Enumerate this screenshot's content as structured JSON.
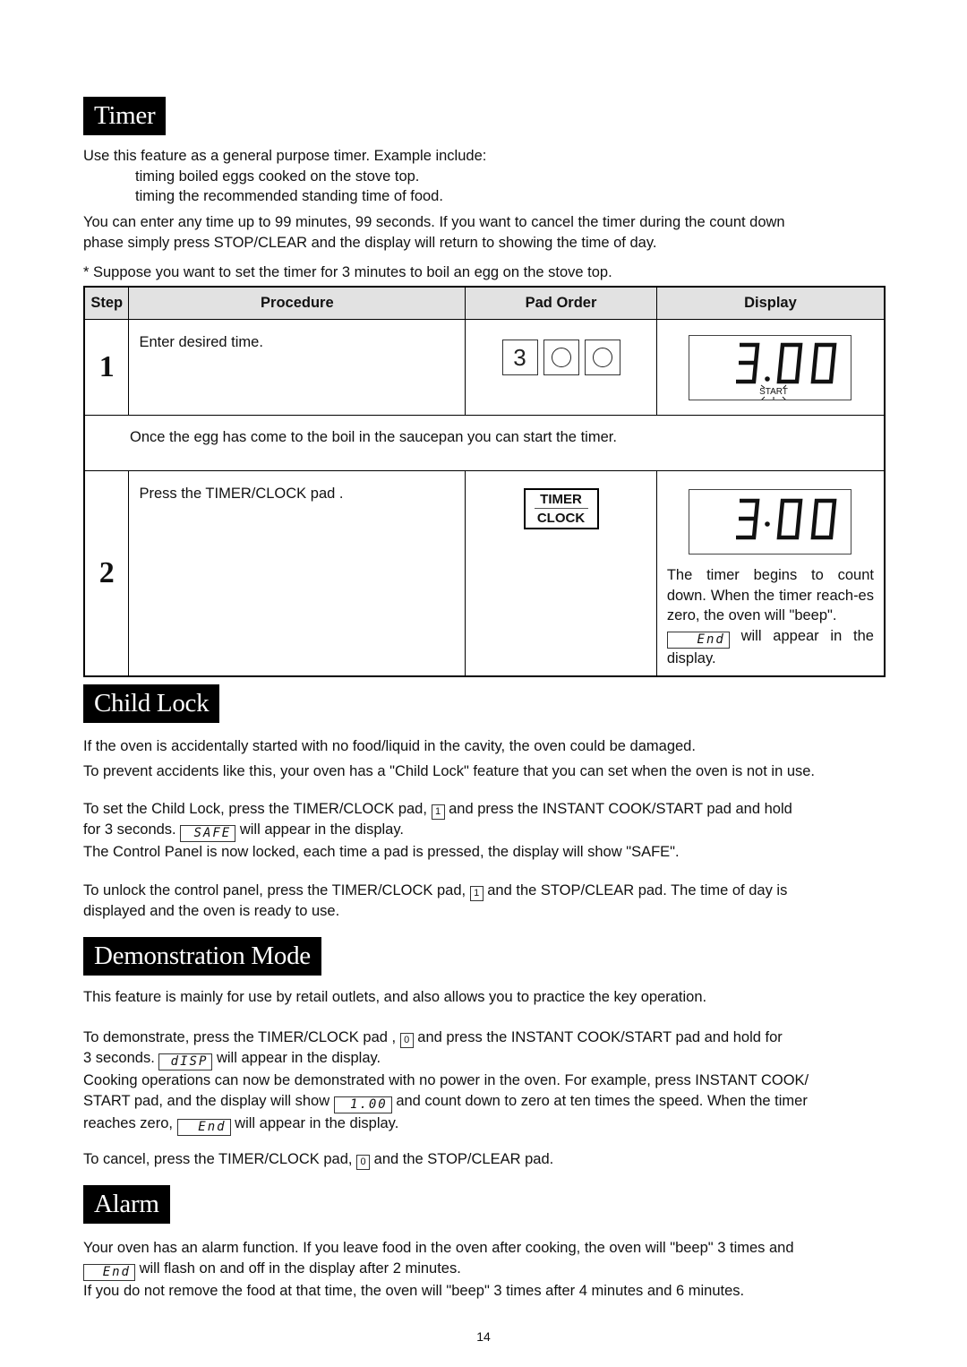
{
  "page_number": "14",
  "timer": {
    "heading": "Timer",
    "intro": "Use this feature as a general purpose timer. Example include:",
    "examples": [
      "timing boiled eggs cooked on the stove top.",
      "timing the recommended standing time of food."
    ],
    "para1_line1": "You can enter any time up to 99 minutes, 99 seconds. If you want to cancel the timer during the count down",
    "para1_line2": "phase simply press STOP/CLEAR and the display will return to showing the time of day.",
    "suppose": "* Suppose you want to set the timer for 3 minutes to boil an egg on the stove top.",
    "table": {
      "headers": [
        "Step",
        "Procedure",
        "Pad Order",
        "Display"
      ],
      "step1": {
        "number": "1",
        "procedure": "Enter desired time.",
        "pads": [
          "3",
          "0",
          "0"
        ],
        "display": "3.00",
        "display_indicator": "START"
      },
      "between": "Once the egg has come to the boil in the saucepan you can start the timer.",
      "step2": {
        "number": "2",
        "procedure": "Press the TIMER/CLOCK pad .",
        "pad_top": "TIMER",
        "pad_bottom": "CLOCK",
        "display": "3.00",
        "note_1": "The timer begins to count down. When the timer reach-es zero, the oven will \"beep\".",
        "note_lcd": "End",
        "note_2": " will appear in the display."
      }
    }
  },
  "child_lock": {
    "heading": "Child Lock",
    "line1": "If the oven is accidentally started with no food/liquid in the cavity, the oven could be damaged.",
    "line2": "To prevent accidents like this, your oven has a \"Child Lock\" feature that you can set when the oven is not in use.",
    "set_a": "To set the Child Lock, press the TIMER/CLOCK pad, ",
    "set_key": "1",
    "set_b": " and press the INSTANT COOK/START pad and hold",
    "set_c": "for 3 seconds. ",
    "set_lcd": "SAFE",
    "set_d": " will appear in the display.",
    "locked": "The Control Panel is now locked, each time a pad is pressed, the display will show \"SAFE\".",
    "unlock_a": "To unlock the control panel, press the TIMER/CLOCK pad, ",
    "unlock_key": "1",
    "unlock_b": " and the STOP/CLEAR pad. The time of day is",
    "unlock_c": "displayed and the oven is ready to use."
  },
  "demo": {
    "heading": "Demonstration Mode",
    "line1": "This feature is mainly for use by retail outlets, and also allows you to practice the key operation.",
    "demo_a": "To demonstrate, press the TIMER/CLOCK pad , ",
    "demo_key": "0",
    "demo_b": " and press the INSTANT COOK/START pad and hold for",
    "demo_c": "3 seconds. ",
    "demo_lcd": "dISP",
    "demo_d": " will appear in the display.",
    "ops_1": "Cooking operations can now be demonstrated with no power in the oven. For example, press INSTANT COOK/",
    "ops_2a": "START pad, and the display will show ",
    "ops_lcd": "1.00",
    "ops_2b": " and count down to zero at ten times the speed. When the timer",
    "ops_3a": "reaches zero, ",
    "ops_3_lcd": "End",
    "ops_3b": " will appear in the display.",
    "cancel_a": "To cancel, press the TIMER/CLOCK pad, ",
    "cancel_key": "0",
    "cancel_b": " and the STOP/CLEAR pad."
  },
  "alarm": {
    "heading": "Alarm",
    "line1": "Your oven has an alarm function. If you leave food in the oven after cooking, the oven will \"beep\" 3 times and",
    "line2_lcd": "End",
    "line2": " will flash on and off in the display after 2 minutes.",
    "line3": "If you do not remove the food at that time, the oven will \"beep\" 3 times after 4 minutes and 6 minutes."
  }
}
